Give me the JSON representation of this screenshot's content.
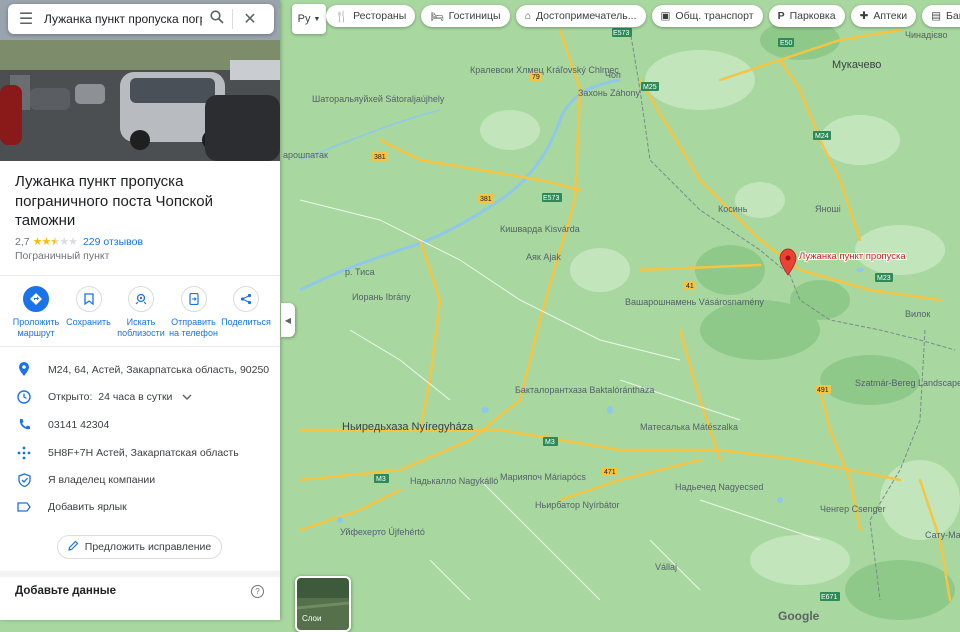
{
  "search": {
    "value": "Лужанка пункт пропуска погранично"
  },
  "place": {
    "title": "Лужанка пункт пропуска пограничного поста Чопской таможни",
    "rating": "2,7",
    "rating_value": 2.7,
    "reviews": "229 отзывов",
    "category": "Пограничный пункт"
  },
  "actions": [
    {
      "label": "Проложить маршрут",
      "icon": "directions-icon"
    },
    {
      "label": "Сохранить",
      "icon": "bookmark-icon"
    },
    {
      "label": "Искать поблизости",
      "icon": "nearby-icon"
    },
    {
      "label": "Отправить на телефон",
      "icon": "send-to-phone-icon"
    },
    {
      "label": "Поделиться",
      "icon": "share-icon"
    }
  ],
  "info": {
    "address": "M24, 64, Астей, Закарпатська область, 90250",
    "hours": "Открыто:  24 часа в сутки",
    "phone": "03141 42304",
    "pluscode": "5H8F+7H Астей, Закарпатская область",
    "owner": "Я владелец компании",
    "label": "Добавить ярлык"
  },
  "suggest_edit": "Предложить исправление",
  "add_data": "Добавьте данные",
  "help": "?",
  "lang": "Ру",
  "chips": [
    {
      "label": "Рестораны",
      "icon": "restaurant-icon"
    },
    {
      "label": "Гостиницы",
      "icon": "hotel-icon"
    },
    {
      "label": "Достопримечатель...",
      "icon": "attraction-icon"
    },
    {
      "label": "Общ. транспорт",
      "icon": "transit-icon"
    },
    {
      "label": "Парковка",
      "icon": "parking-icon"
    },
    {
      "label": "Аптеки",
      "icon": "pharmacy-icon"
    },
    {
      "label": "Банком",
      "icon": "atm-icon"
    }
  ],
  "layers_label": "Слои",
  "google": "Google",
  "marker_label": "Лужанка пункт пропуска",
  "colors": {
    "map_green": "#a8d8a0",
    "map_light": "#c9e8c0",
    "road_yellow": "#f6c443",
    "accent_blue": "#1a73e8",
    "marker_red": "#ea4335",
    "river": "#8fc8e8"
  },
  "map_labels": {
    "mukachevo": "Мукачево",
    "chop": "Чоп",
    "zahony": "Захонь Záhony",
    "kralovsky": "Кралевски Хлмец Kráľovský Chlmec",
    "satoraljaujhely": "Шаторальяуйхей Sátoraljaújhely",
    "saros": "арошпатак",
    "kisvarda": "Кишварда Kisvárda",
    "ajak": "Аяк Ajak",
    "tisza": "р. Тиса",
    "ibrany": "Иорань Ibrány",
    "vasarosnameny": "Вашарошнамень Vásárosnamény",
    "baktalorantshaza": "Бакталорантхаза Baktalórántháza",
    "nyiregyhaza": "Ньиредьхаза Nyíregyháza",
    "mateszalka": "Матесалька Mátészalka",
    "nagykallo": "Надькалло Nagykálló",
    "mariapocs": "Марияпоч Máriapócs",
    "nyirbator": "Ньирбатор Nyírbátor",
    "nagyecsed": "Надьечед Nagyecsed",
    "csenger": "Ченгер Csenger",
    "ujfeherto": "Уйфехерто Újfehértó",
    "vallaj": "Vállaj",
    "satu_mare": "Сату-Маре Satu Mare",
    "kosyno": "Косинь",
    "yanoshi": "Яноші",
    "vilok": "Вилок",
    "nizhnee": "Чинадієво",
    "szatmar": "Szatmár-Bereg Landscape Protection Area"
  },
  "road_numbers": [
    "M24",
    "M25",
    "M3",
    "M3",
    "381",
    "381",
    "381",
    "79",
    "E573",
    "E573",
    "41",
    "491",
    "471",
    "E50",
    "M23",
    "E671"
  ]
}
